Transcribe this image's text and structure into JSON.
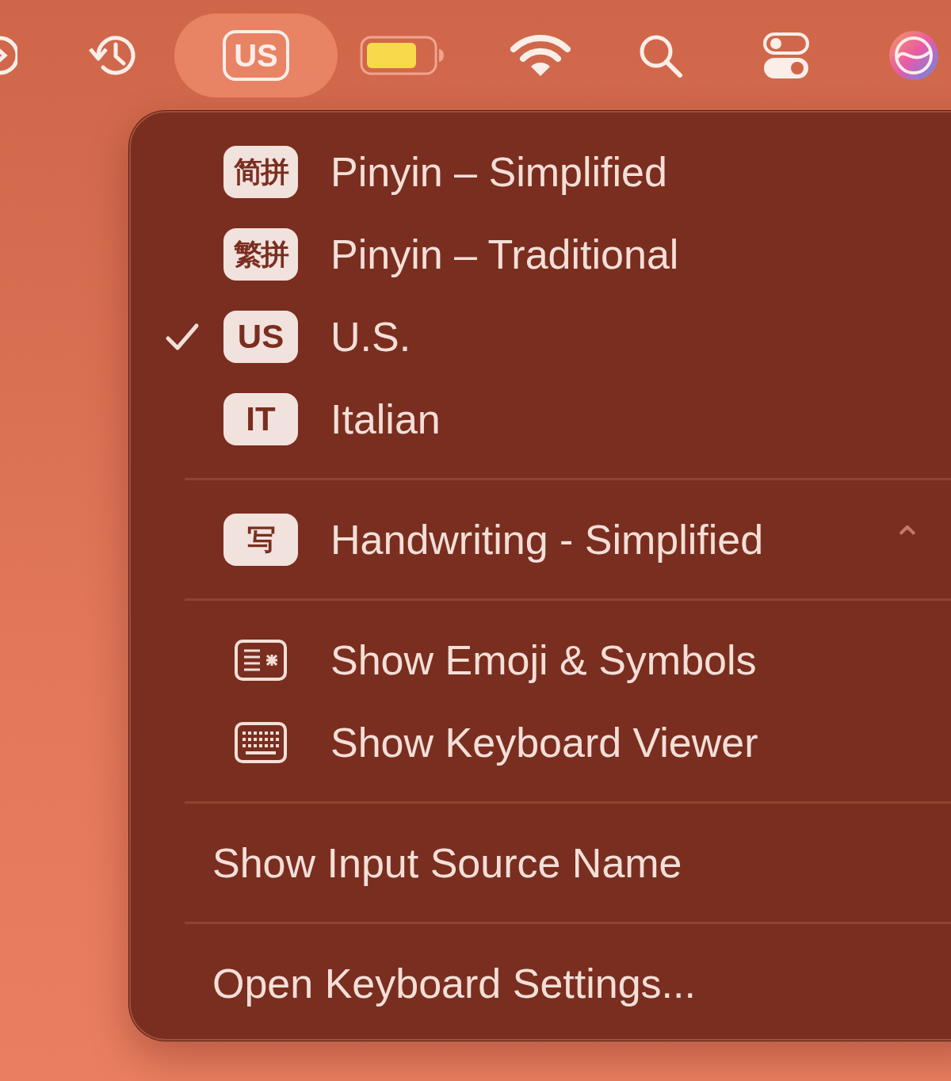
{
  "menu_bar": {
    "input_source": {
      "label": "US",
      "selected": true
    }
  },
  "menu": {
    "groups": [
      {
        "items": [
          {
            "kind": "source",
            "badge": "简拼",
            "label": "Pinyin – Simplified",
            "selected": false
          },
          {
            "kind": "source",
            "badge": "繁拼",
            "label": "Pinyin – Traditional",
            "selected": false
          },
          {
            "kind": "source",
            "badge": "US",
            "label": "U.S.",
            "selected": true
          },
          {
            "kind": "source",
            "badge": "IT",
            "label": "Italian",
            "selected": false
          }
        ]
      },
      {
        "items": [
          {
            "kind": "source",
            "badge": "写",
            "label": "Handwriting - Simplified",
            "shortcut": "⌃",
            "selected": false
          }
        ]
      },
      {
        "items": [
          {
            "kind": "emoji",
            "label": "Show Emoji & Symbols"
          },
          {
            "kind": "keyboard",
            "label": "Show Keyboard Viewer"
          }
        ]
      },
      {
        "items": [
          {
            "kind": "plain",
            "label": "Show Input Source Name"
          }
        ]
      },
      {
        "items": [
          {
            "kind": "plain",
            "label": "Open Keyboard Settings..."
          }
        ]
      }
    ]
  }
}
